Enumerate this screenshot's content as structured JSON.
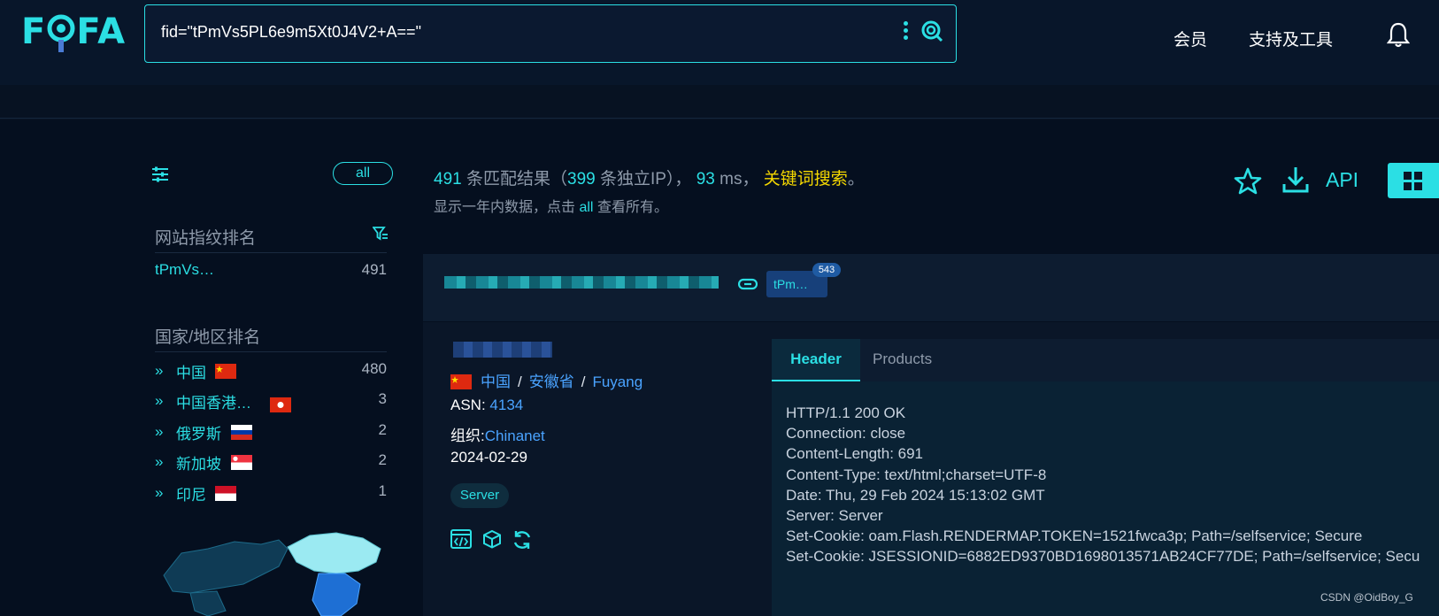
{
  "app": {
    "logo_text": "FOFA",
    "search_query": "fid=\"tPmVs5PL6e9m5Xt0J4V2+A==\""
  },
  "nav": {
    "member": "会员",
    "tools": "支持及工具"
  },
  "sidebar": {
    "all_button": "all",
    "fingerprint_title": "网站指纹排名",
    "fingerprints": [
      {
        "name": "tPmVs…",
        "count": "491"
      }
    ],
    "country_title": "国家/地区排名",
    "countries": [
      {
        "name": "中国",
        "count": "480",
        "flag": "cn"
      },
      {
        "name": "中国香港…",
        "count": "3",
        "flag": "hk"
      },
      {
        "name": "俄罗斯",
        "count": "2",
        "flag": "ru"
      },
      {
        "name": "新加坡",
        "count": "2",
        "flag": "sg"
      },
      {
        "name": "印尼",
        "count": "1",
        "flag": "id"
      }
    ]
  },
  "results": {
    "total": "491",
    "matches_label": "条匹配结果（",
    "unique_ip": "399",
    "unique_ip_label": "条独立IP），",
    "ms": "93",
    "ms_label": "ms，",
    "keyword_search": "关键词搜索",
    "period": "。",
    "note_prefix": "显示一年内数据，点击",
    "note_all": "all",
    "note_suffix": "查看所有。",
    "api_label": "API"
  },
  "card": {
    "tag_label": "tPm…",
    "tag_count": "543",
    "location": {
      "country": "中国",
      "province": "安徽省",
      "city": "Fuyang",
      "sep": "/"
    },
    "asn_label": "ASN:",
    "asn": "4134",
    "org_label": "组织:",
    "org": "Chinanet",
    "date": "2024-02-29",
    "server_tag": "Server",
    "tabs": {
      "header": "Header",
      "products": "Products"
    },
    "header_lines": [
      "HTTP/1.1 200 OK",
      "Connection: close",
      "Content-Length: 691",
      "Content-Type: text/html;charset=UTF-8",
      "Date: Thu, 29 Feb 2024 15:13:02 GMT",
      "Server: Server",
      "Set-Cookie: oam.Flash.RENDERMAP.TOKEN=1521fwca3p; Path=/selfservice; Secure",
      "Set-Cookie: JSESSIONID=6882ED9370BD1698013571AB24CF77DE; Path=/selfservice; Secu"
    ]
  },
  "watermark": "CSDN @OidBoy_G",
  "colors": {
    "accent": "#2bdfe4",
    "link": "#4aa3ff",
    "keyword": "#f5d800",
    "bg": "#050f1f"
  }
}
